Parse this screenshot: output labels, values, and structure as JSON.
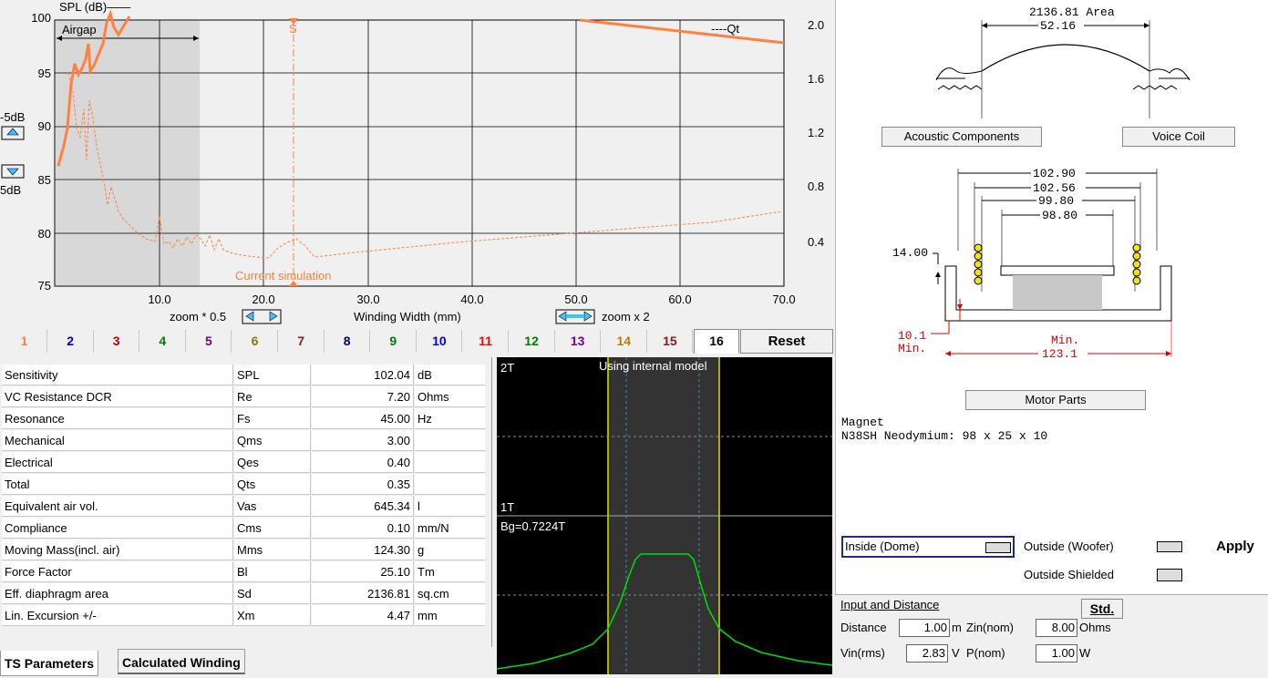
{
  "chart": {
    "spl_label": "SPL (dB)——",
    "qt_label": "----Qt",
    "airgap_label": "Airgap",
    "current_sim_label": "Current simulation",
    "s_marker": "S",
    "left_ticks": [
      "100",
      "95",
      "90",
      "85",
      "80",
      "75"
    ],
    "right_ticks": [
      "2.0",
      "1.6",
      "1.2",
      "0.8",
      "0.4"
    ],
    "x_ticks": [
      "10.0",
      "20.0",
      "30.0",
      "40.0",
      "50.0",
      "60.0",
      "70.0"
    ],
    "xlabel": "Winding Width (mm)",
    "zoom_out_label": "zoom * 0.5",
    "zoom_in_label": "zoom x 2",
    "plus5_label": "-5dB",
    "minus5_label": "5dB",
    "colors": {
      "spl": "#ff8040",
      "plot_bg": "#f0f0f0",
      "airgap_bg": "#d8d8d8"
    }
  },
  "tabs": {
    "numbers": [
      {
        "label": "1",
        "color": "#ff8040"
      },
      {
        "label": "2",
        "color": "#0000c0"
      },
      {
        "label": "3",
        "color": "#c00000"
      },
      {
        "label": "4",
        "color": "#008000"
      },
      {
        "label": "5",
        "color": "#800080"
      },
      {
        "label": "6",
        "color": "#808000"
      },
      {
        "label": "7",
        "color": "#802020"
      },
      {
        "label": "8",
        "color": "#000080"
      },
      {
        "label": "9",
        "color": "#008000"
      },
      {
        "label": "10",
        "color": "#0000ff"
      },
      {
        "label": "11",
        "color": "#ff0000"
      },
      {
        "label": "12",
        "color": "#008000"
      },
      {
        "label": "13",
        "color": "#800080"
      },
      {
        "label": "14",
        "color": "#b08000"
      },
      {
        "label": "15",
        "color": "#802020"
      },
      {
        "label": "16",
        "color": "#000000"
      }
    ],
    "reset_label": "Reset"
  },
  "ts_params": [
    {
      "name": "Sensitivity",
      "sym": "SPL",
      "value": "102.04",
      "unit": "dB"
    },
    {
      "name": "VC Resistance DCR",
      "sym": "Re",
      "value": "7.20",
      "unit": "Ohms"
    },
    {
      "name": "Resonance",
      "sym": "Fs",
      "value": "45.00",
      "unit": "Hz"
    },
    {
      "name": "Mechanical",
      "sym": "Qms",
      "value": "3.00",
      "unit": ""
    },
    {
      "name": "Electrical",
      "sym": "Qes",
      "value": "0.40",
      "unit": ""
    },
    {
      "name": "Total",
      "sym": "Qts",
      "value": "0.35",
      "unit": ""
    },
    {
      "name": "Equivalent air vol.",
      "sym": "Vas",
      "value": "645.34",
      "unit": "l"
    },
    {
      "name": "Compliance",
      "sym": "Cms",
      "value": "0.10",
      "unit": "mm/N"
    },
    {
      "name": "Moving Mass(incl. air)",
      "sym": "Mms",
      "value": "124.30",
      "unit": "g"
    },
    {
      "name": "Force Factor",
      "sym": "Bl",
      "value": "25.10",
      "unit": "Tm"
    },
    {
      "name": "Eff. diaphragm area",
      "sym": "Sd",
      "value": "2136.81",
      "unit": "sq.cm"
    },
    {
      "name": "Lin. Excursion +/-",
      "sym": "Xm",
      "value": "4.47",
      "unit": "mm"
    }
  ],
  "bottom_tabs": {
    "ts": "TS Parameters",
    "calc": "Calculated Winding"
  },
  "gap_plot": {
    "title": "Using internal model",
    "label_2t": "2T",
    "label_1t": "1T",
    "bg_label": "Bg=0.7224T"
  },
  "drawing": {
    "area": "2136.81 Area",
    "dome_width": "52.16",
    "acoustic_btn": "Acoustic Components",
    "voicecoil_btn": "Voice Coil",
    "dims": [
      "102.90",
      "102.56",
      "99.80",
      "98.80"
    ],
    "height": "14.00",
    "depth1": "10.1",
    "depth2": "Min.",
    "width_min": "Min.",
    "width_val": "123.1",
    "motor_btn": "Motor Parts",
    "magnet_label": "Magnet",
    "magnet_desc": "N38SH Neodymium: 98 x 25 x 10"
  },
  "motor_options": {
    "inside": "Inside (Dome)",
    "outside_woofer": "Outside (Woofer)",
    "outside_shielded": "Outside Shielded",
    "apply": "Apply"
  },
  "input_distance": {
    "title": "Input and Distance",
    "std_btn": "Std.",
    "distance_label": "Distance",
    "distance_value": "1.00",
    "distance_unit": "m",
    "zin_label": "Zin(nom)",
    "zin_value": "8.00",
    "zin_unit": "Ohms",
    "vin_label": "Vin(rms)",
    "vin_value": "2.83",
    "vin_unit": "V",
    "pnom_label": "P(nom)",
    "pnom_value": "1.00",
    "pnom_unit": "W"
  }
}
